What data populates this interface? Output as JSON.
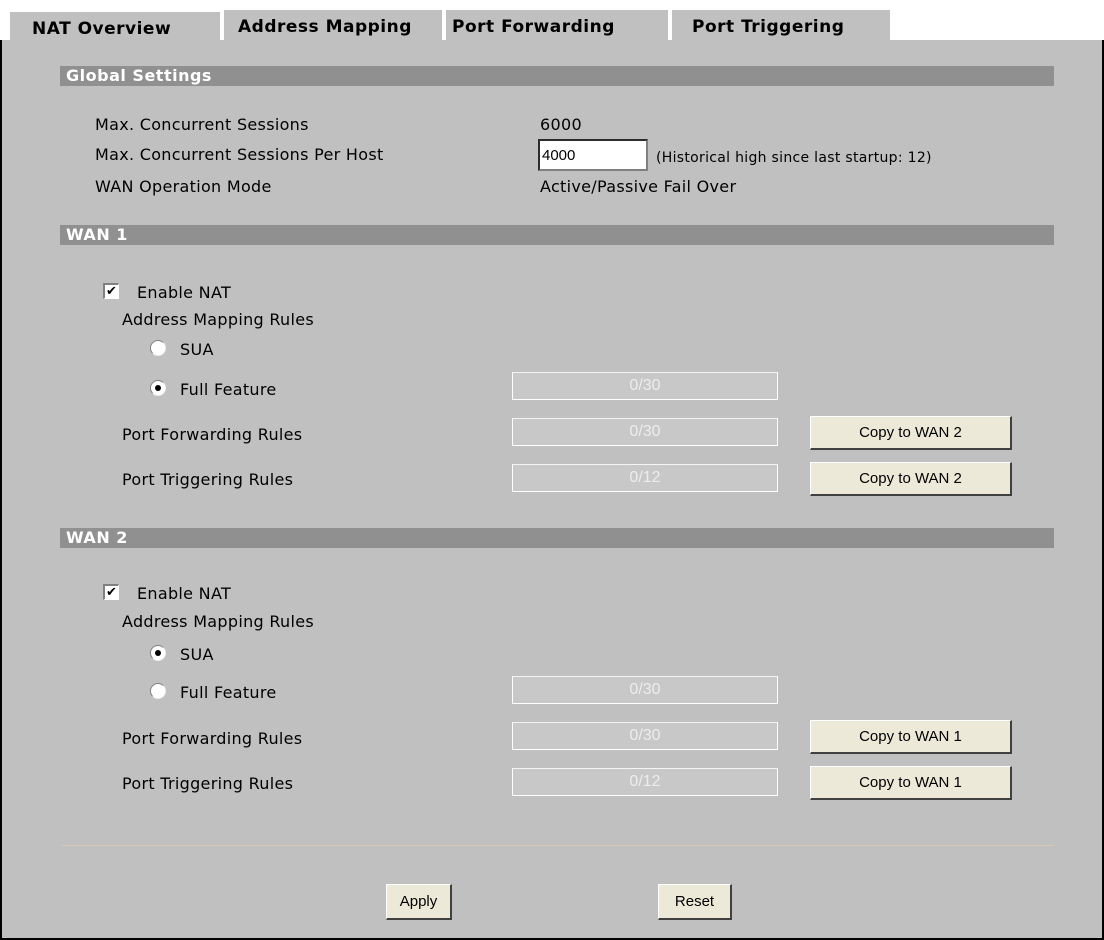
{
  "tabs": [
    {
      "label": "NAT Overview",
      "active": true
    },
    {
      "label": "Address Mapping",
      "active": false
    },
    {
      "label": "Port Forwarding",
      "active": false
    },
    {
      "label": "Port Triggering",
      "active": false
    }
  ],
  "global": {
    "title": "Global Settings",
    "max_sessions_label": "Max. Concurrent Sessions",
    "max_sessions_value": "6000",
    "per_host_label": "Max. Concurrent Sessions Per Host",
    "per_host_value": "4000",
    "historical_note": "(Historical high since last startup: 12)",
    "wan_mode_label": "WAN Operation Mode",
    "wan_mode_value": "Active/Passive Fail Over"
  },
  "wan1": {
    "title": "WAN 1",
    "enable_nat_label": "Enable NAT",
    "enable_nat": true,
    "mapping_label": "Address Mapping Rules",
    "sua_label": "SUA",
    "full_label": "Full Feature",
    "selected": "Full Feature",
    "full_count": "0/30",
    "pf_label": "Port Forwarding Rules",
    "pf_count": "0/30",
    "pf_copy": "Copy to WAN 2",
    "pt_label": "Port Triggering Rules",
    "pt_count": "0/12",
    "pt_copy": "Copy to WAN 2"
  },
  "wan2": {
    "title": "WAN 2",
    "enable_nat_label": "Enable NAT",
    "enable_nat": true,
    "mapping_label": "Address Mapping Rules",
    "sua_label": "SUA",
    "full_label": "Full Feature",
    "selected": "SUA",
    "full_count": "0/30",
    "pf_label": "Port Forwarding Rules",
    "pf_count": "0/30",
    "pf_copy": "Copy to WAN 1",
    "pt_label": "Port Triggering Rules",
    "pt_count": "0/12",
    "pt_copy": "Copy to WAN 1"
  },
  "actions": {
    "apply": "Apply",
    "reset": "Reset"
  }
}
